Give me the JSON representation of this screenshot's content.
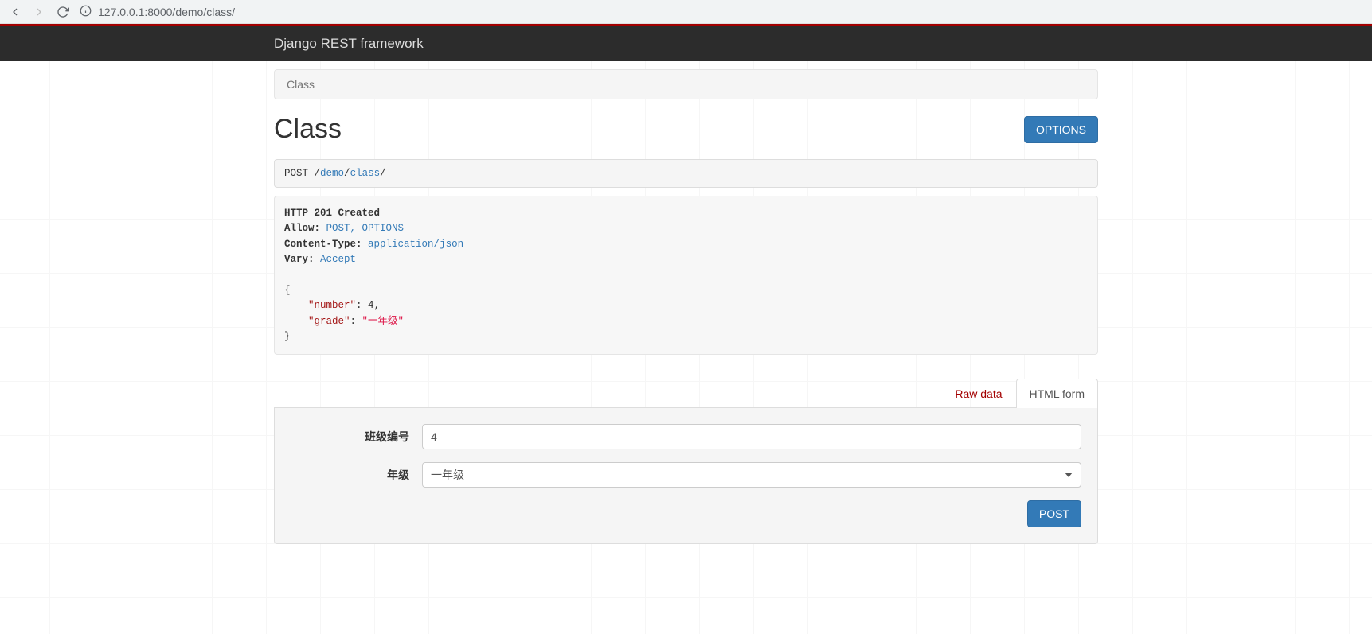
{
  "browser": {
    "url_display": "127.0.0.1:8000/demo/class/",
    "url_host": "127.0.0.1",
    "url_port_path": ":8000/demo/class/"
  },
  "navbar": {
    "brand": "Django REST framework"
  },
  "breadcrumb": {
    "current": "Class"
  },
  "page": {
    "title": "Class",
    "options_btn": "OPTIONS"
  },
  "request": {
    "method": "POST",
    "path_prefix": " /",
    "seg1": "demo",
    "sep1": "/",
    "seg2": "class",
    "sep2": "/"
  },
  "response": {
    "status_line": "HTTP 201 Created",
    "allow_label": "Allow:",
    "allow_value": "POST, OPTIONS",
    "ctype_label": "Content-Type:",
    "ctype_value": "application/json",
    "vary_label": "Vary:",
    "vary_value": "Accept",
    "body": {
      "open": "{",
      "k1": "\"number\"",
      "colon1": ": ",
      "v1": "4",
      "comma1": ",",
      "k2": "\"grade\"",
      "colon2": ": ",
      "v2": "\"一年级\"",
      "close": "}"
    }
  },
  "tabs": {
    "raw": "Raw data",
    "html": "HTML form"
  },
  "form": {
    "number_label": "班级编号",
    "number_value": "4",
    "grade_label": "年级",
    "grade_value": "一年级",
    "submit": "POST"
  }
}
